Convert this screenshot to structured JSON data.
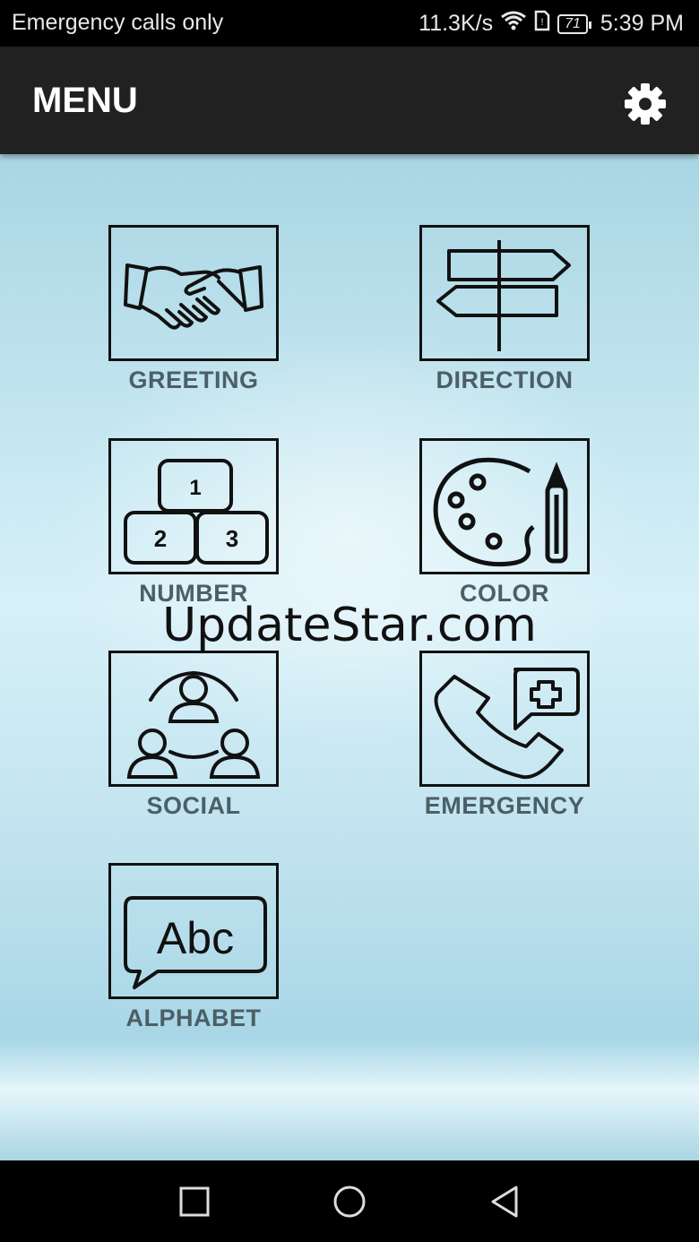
{
  "status_bar": {
    "carrier_text": "Emergency calls only",
    "speed": "11.3K/s",
    "battery": "71",
    "time": "5:39 PM"
  },
  "app_bar": {
    "title": "MENU",
    "settings_icon": "gear-icon"
  },
  "menu": {
    "items": [
      {
        "label": "GREETING",
        "icon": "handshake-icon"
      },
      {
        "label": "DIRECTION",
        "icon": "signpost-icon"
      },
      {
        "label": "NUMBER",
        "icon": "number-blocks-icon"
      },
      {
        "label": "COLOR",
        "icon": "palette-icon"
      },
      {
        "label": "SOCIAL",
        "icon": "people-network-icon"
      },
      {
        "label": "EMERGENCY",
        "icon": "phone-medical-icon"
      },
      {
        "label": "ALPHABET",
        "icon": "abc-speech-icon"
      }
    ]
  },
  "watermark": "UpdateStar.com",
  "nav_bar": {
    "recents_icon": "square-icon",
    "home_icon": "circle-icon",
    "back_icon": "triangle-back-icon"
  }
}
